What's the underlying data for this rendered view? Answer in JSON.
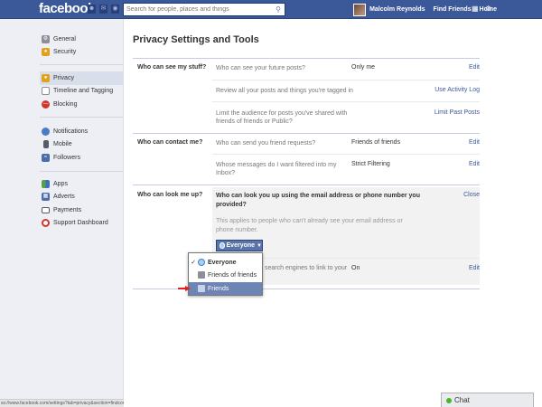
{
  "topbar": {
    "logo": "facebook",
    "search_placeholder": "Search for people, places and things",
    "user_name": "Malcolm Reynolds",
    "find_friends": "Find Friends",
    "home": "Home"
  },
  "leftnav": {
    "group1": [
      {
        "label": "General",
        "icon": "gear-icon"
      },
      {
        "label": "Security",
        "icon": "lock-icon"
      }
    ],
    "group2": [
      {
        "label": "Privacy",
        "icon": "privacy-lock-icon"
      },
      {
        "label": "Timeline and Tagging",
        "icon": "timeline-icon"
      },
      {
        "label": "Blocking",
        "icon": "block-icon"
      }
    ],
    "group3": [
      {
        "label": "Notifications",
        "icon": "globe-icon"
      },
      {
        "label": "Mobile",
        "icon": "phone-icon"
      },
      {
        "label": "Followers",
        "icon": "rss-icon"
      }
    ],
    "group4": [
      {
        "label": "Apps",
        "icon": "apps-icon"
      },
      {
        "label": "Adverts",
        "icon": "adverts-icon"
      },
      {
        "label": "Payments",
        "icon": "card-icon"
      },
      {
        "label": "Support Dashboard",
        "icon": "lifebuoy-icon"
      }
    ]
  },
  "main": {
    "title": "Privacy Settings and Tools",
    "sections": [
      {
        "label": "Who can see my stuff?",
        "rows": [
          {
            "q": "Who can see your future posts?",
            "v": "Only me",
            "a": "Edit"
          },
          {
            "q": "Review all your posts and things you're tagged in",
            "v": "",
            "a": "Use Activity Log"
          },
          {
            "q": "Limit the audience for posts you've shared with friends of friends or Public?",
            "v": "",
            "a": "Limit Past Posts"
          }
        ]
      },
      {
        "label": "Who can contact me?",
        "rows": [
          {
            "q": "Who can send you friend requests?",
            "v": "Friends of friends",
            "a": "Edit"
          },
          {
            "q": "Whose messages do I want filtered into my Inbox?",
            "v": "Strict Filtering",
            "a": "Edit"
          }
        ]
      },
      {
        "label": "Who can look me up?",
        "expanded": {
          "q": "Who can look you up using the email address or phone number you provided?",
          "note": "This applies to people who can't already see your email address or phone number.",
          "close": "Close",
          "selected": "Everyone"
        },
        "rows": [
          {
            "q": "search engines to link to your",
            "v": "On",
            "a": "Edit"
          }
        ]
      }
    ]
  },
  "dropdown": {
    "options": [
      "Everyone",
      "Friends of friends",
      "Friends"
    ],
    "checked": "Everyone",
    "highlighted": "Friends"
  },
  "statusbar": "ss://www.facebook.com/settings?tab=privacy&section=findcontact&view",
  "chat": "Chat",
  "colors": {
    "brand": "#3b5998",
    "highlight": "#6d84b4",
    "link": "#3b5998"
  }
}
